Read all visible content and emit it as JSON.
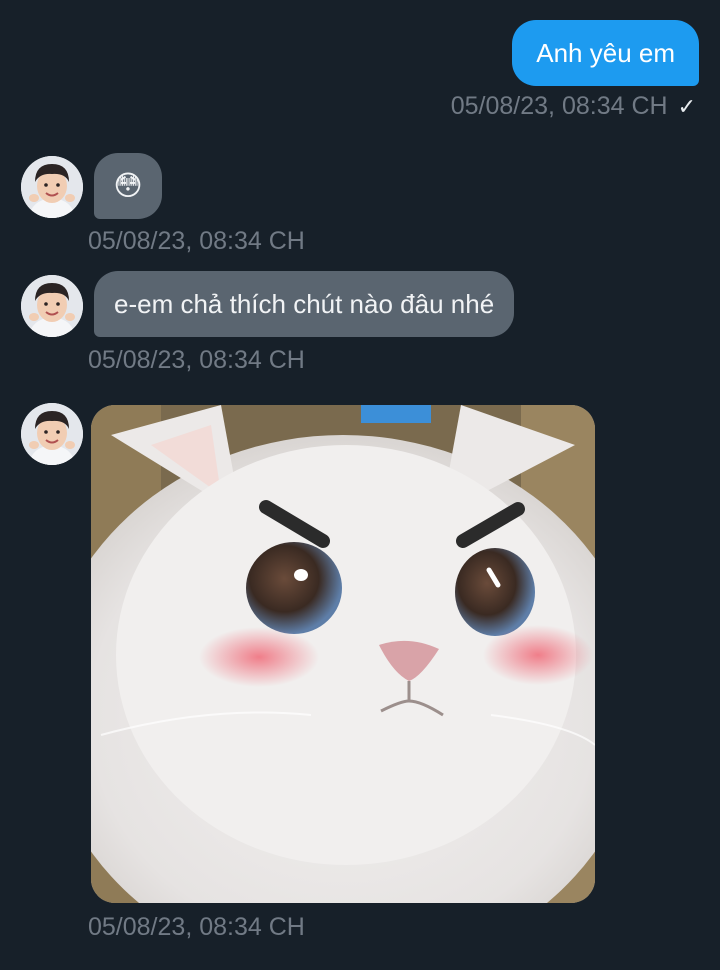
{
  "messages": [
    {
      "direction": "outgoing",
      "text": "Anh yêu em",
      "timestamp": "05/08/23, 08:34 CH",
      "status_icon": "check-icon",
      "status_glyph": "✓"
    },
    {
      "direction": "incoming",
      "text": "😳",
      "timestamp": "05/08/23, 08:34 CH",
      "avatar": "profile-avatar"
    },
    {
      "direction": "incoming",
      "text": "e-em chả thích chút nào đâu nhé",
      "timestamp": "05/08/23, 08:34 CH",
      "avatar": "profile-avatar"
    },
    {
      "direction": "incoming",
      "media": "angry-cat-image",
      "timestamp": "05/08/23, 08:34 CH",
      "avatar": "profile-avatar"
    }
  ],
  "colors": {
    "background": "#172029",
    "outgoing_bubble": "#1d9bf0",
    "incoming_bubble": "#5a6570",
    "timestamp": "#717a85"
  }
}
